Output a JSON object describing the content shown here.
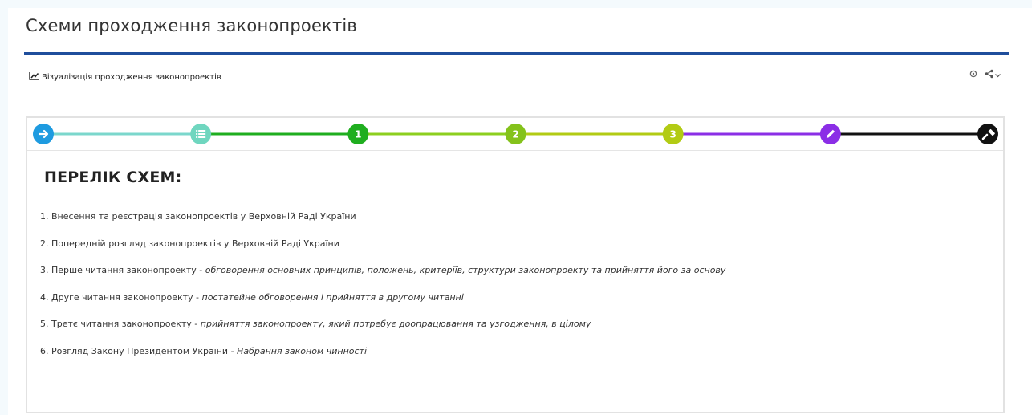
{
  "page": {
    "title": "Схеми проходження законопроектів"
  },
  "widget": {
    "title": "Візуалізація проходження законопроектів",
    "actions": [
      "settings-icon",
      "share-icon",
      "caret-down-icon"
    ]
  },
  "colors": {
    "title_rule": "#1f4e9c",
    "step_colors": [
      "#1e9be0",
      "#6fd6bf",
      "#1fae1f",
      "#84c21b",
      "#b2cb14",
      "#8b2ee6",
      "#111111"
    ],
    "connector_colors": [
      "#7bd7cc",
      "#1fae1f",
      "#8ccf1f",
      "#b2cb14",
      "#8b2ee6",
      "#111111"
    ]
  },
  "steps": [
    {
      "icon": "arrow-right-icon",
      "label": ""
    },
    {
      "icon": "list-icon",
      "label": ""
    },
    {
      "icon": "",
      "label": "1"
    },
    {
      "icon": "",
      "label": "2"
    },
    {
      "icon": "",
      "label": "3"
    },
    {
      "icon": "pencil-icon",
      "label": ""
    },
    {
      "icon": "gavel-icon",
      "label": ""
    }
  ],
  "list": {
    "heading": "ПЕРЕЛІК СХЕМ:",
    "items": [
      {
        "text": "1. Внесення та реєстрація законопроектів у Верховній Раді України",
        "desc": ""
      },
      {
        "text": "2. Попередній розгляд законопроектів у Верховній Раді України",
        "desc": ""
      },
      {
        "text": "3. Перше читання законопроекту - ",
        "desc": "обговорення основних принципів, положень, критеріїв, структури законопроекту та прийняття його за основу"
      },
      {
        "text": "4. Друге читання законопроекту - ",
        "desc": "постатейне обговорення і прийняття в другому читанні"
      },
      {
        "text": "5. Третє читання законопроекту - ",
        "desc": "прийняття законопроекту, який потребує доопрацювання та узгодження, в цілому"
      },
      {
        "text": "6. Розгляд Закону Президентом України - ",
        "desc": "Набрання законом чинності"
      }
    ]
  }
}
